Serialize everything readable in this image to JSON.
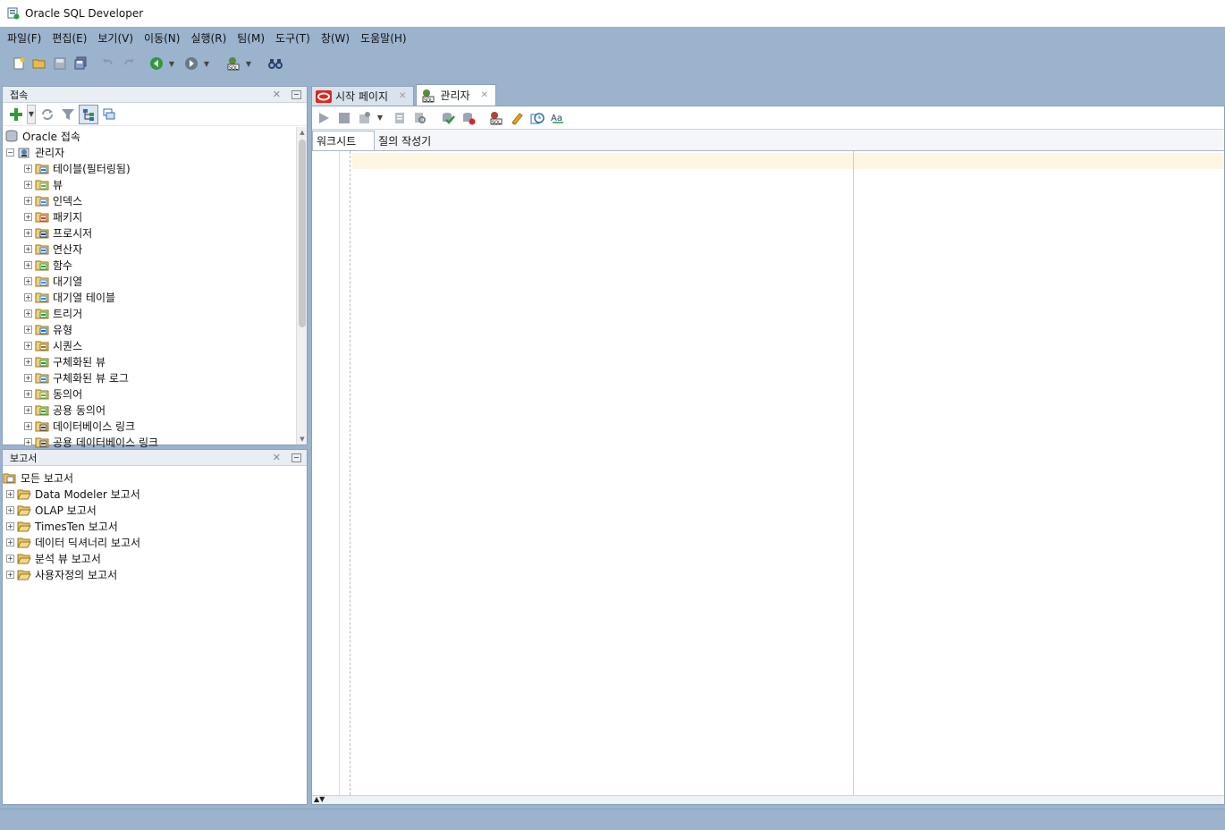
{
  "window": {
    "title": "Oracle SQL Developer"
  },
  "menu": [
    "파일(F)",
    "편집(E)",
    "보기(V)",
    "이동(N)",
    "실행(R)",
    "팀(M)",
    "도구(T)",
    "창(W)",
    "도움말(H)"
  ],
  "connections_panel": {
    "title": "접속",
    "root": "Oracle 접속",
    "connection": "관리자",
    "items": [
      "테이블(필터링됨)",
      "뷰",
      "인덱스",
      "패키지",
      "프로시저",
      "연산자",
      "함수",
      "대기열",
      "대기열 테이블",
      "트리거",
      "유형",
      "시퀀스",
      "구체화된 뷰",
      "구체화된 뷰 로그",
      "동의어",
      "공용 동의어",
      "데이터베이스 링크",
      "공용 데이터베이스 링크"
    ]
  },
  "reports_panel": {
    "title": "보고서",
    "root": "모든 보고서",
    "items": [
      "Data Modeler 보고서",
      "OLAP 보고서",
      "TimesTen 보고서",
      "데이터 딕셔너리 보고서",
      "분석 뷰 보고서",
      "사용자정의 보고서"
    ]
  },
  "editor": {
    "tabs": [
      {
        "label": "시작 페이지",
        "icon": "oracle-icon"
      },
      {
        "label": "관리자",
        "icon": "sql-connection-icon"
      }
    ],
    "subtabs": [
      "워크시트",
      "질의 작성기"
    ]
  },
  "colors": {
    "chrome": "#9bb3cc",
    "border": "#8aa0b8",
    "current_line": "#fdf6e3"
  }
}
